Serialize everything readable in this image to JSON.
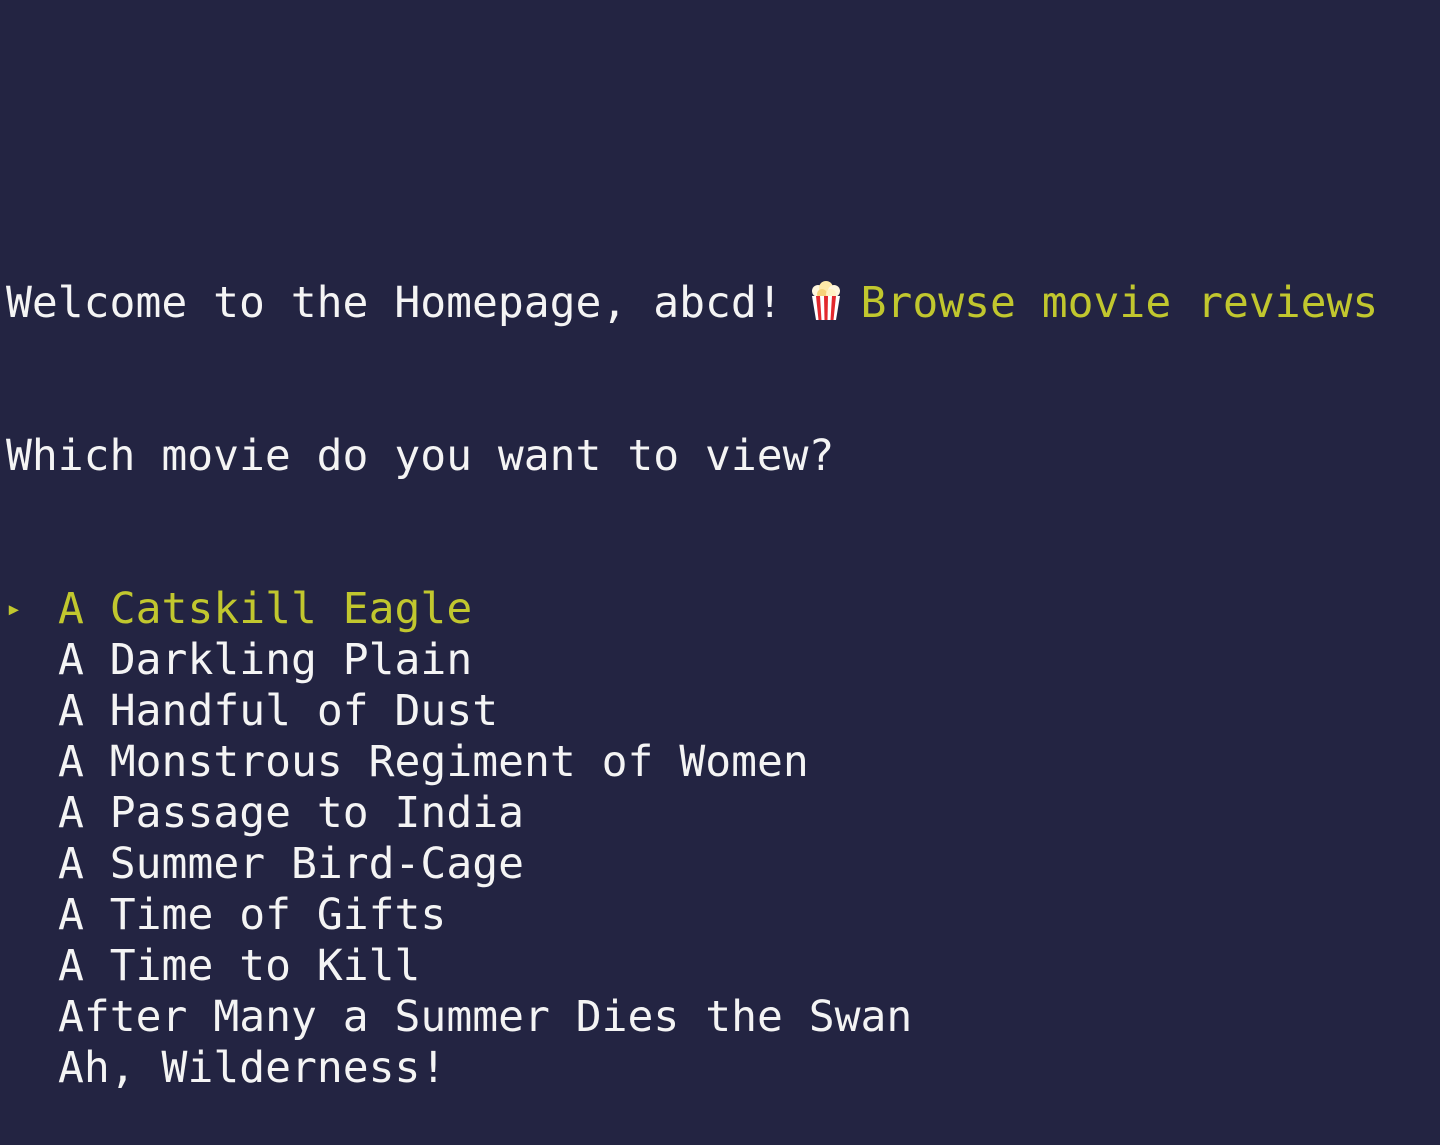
{
  "header": {
    "welcome_text": "Welcome to the Homepage, abcd! ",
    "popcorn_icon": "popcorn-icon",
    "browse_text": "Browse movie reviews",
    "accent_color": "#c1c72e"
  },
  "prompt": {
    "question": "Which movie do you want to view?"
  },
  "menu": {
    "cursor": "▸",
    "selected_index": 0,
    "items": [
      {
        "label": "A Catskill Eagle"
      },
      {
        "label": "A Darkling Plain"
      },
      {
        "label": "A Handful of Dust"
      },
      {
        "label": "A Monstrous Regiment of Women"
      },
      {
        "label": "A Passage to India"
      },
      {
        "label": "A Summer Bird-Cage"
      },
      {
        "label": "A Time of Gifts"
      },
      {
        "label": "A Time to Kill"
      },
      {
        "label": "After Many a Summer Dies the Swan"
      },
      {
        "label": "Ah, Wilderness!"
      }
    ]
  }
}
